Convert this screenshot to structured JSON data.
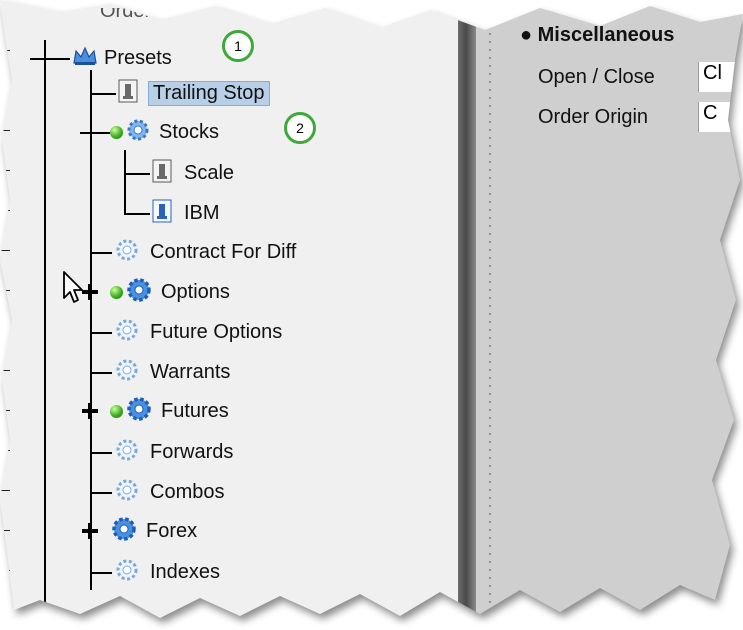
{
  "tree": {
    "partial_header": "Orders",
    "root_label": "Presets",
    "items": [
      {
        "label": "Trailing Stop",
        "selected": true
      },
      {
        "label": "Stocks"
      },
      {
        "label": "Scale"
      },
      {
        "label": "IBM"
      },
      {
        "label": "Contract For Diff"
      },
      {
        "label": "Options"
      },
      {
        "label": "Future Options"
      },
      {
        "label": "Warrants"
      },
      {
        "label": "Futures"
      },
      {
        "label": "Forwards"
      },
      {
        "label": "Combos"
      },
      {
        "label": "Forex"
      },
      {
        "label": "Indexes"
      }
    ]
  },
  "callouts": [
    "1",
    "2"
  ],
  "right_panel": {
    "section_title": "Miscellaneous",
    "fields": [
      {
        "label": "Open / Close",
        "value": "Cl"
      },
      {
        "label": "Order Origin",
        "value": "C"
      }
    ]
  },
  "colors": {
    "accent_green": "#3ea83a",
    "selection": "#b8cfe8",
    "gear_blue": "#4a8fe0"
  },
  "icons": [
    "crown-icon",
    "order-icon",
    "gear-icon",
    "green-ball-icon",
    "cursor-icon"
  ]
}
